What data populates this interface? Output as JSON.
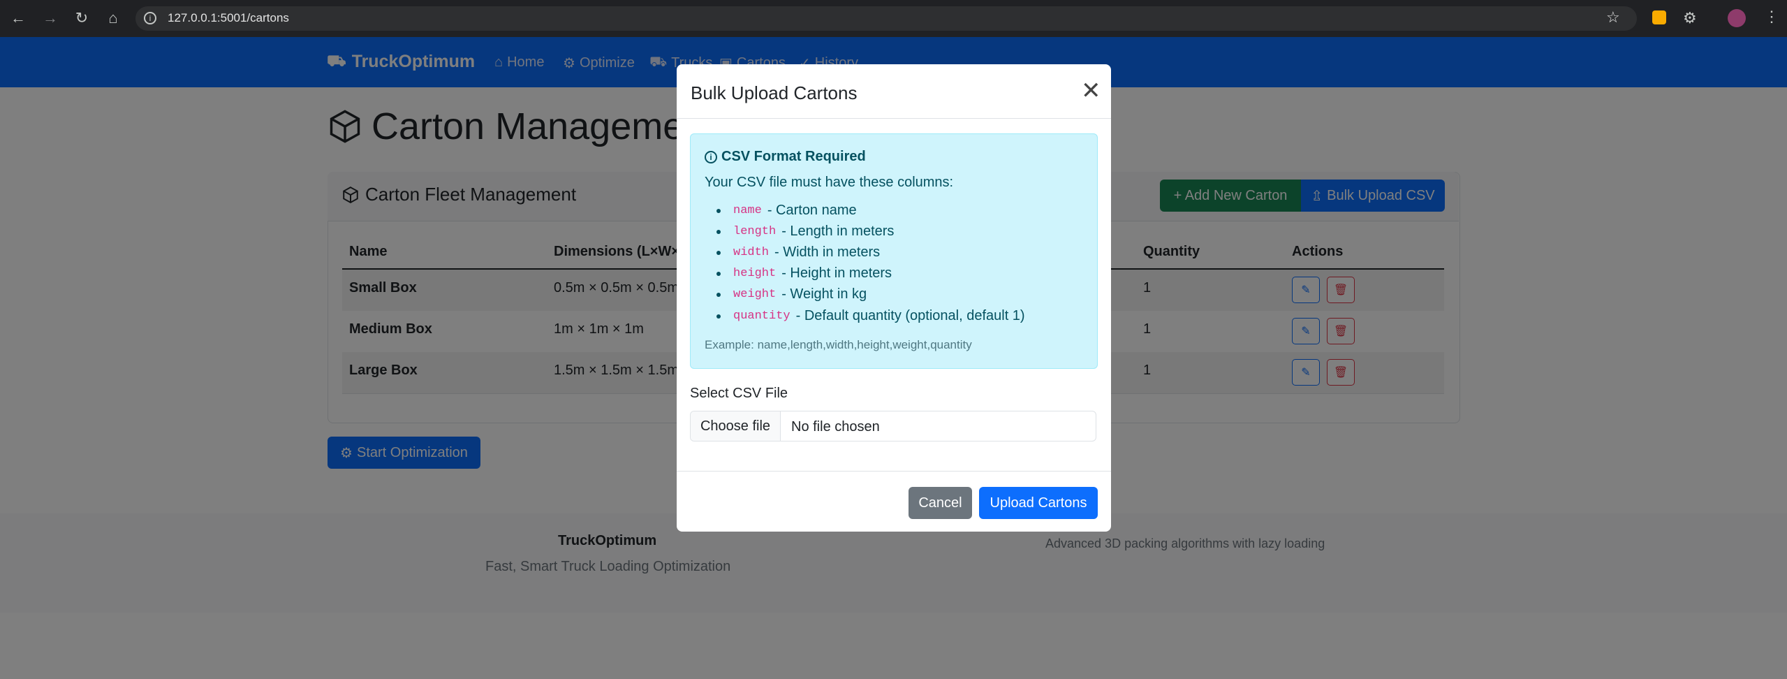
{
  "browser": {
    "url": "127.0.0.1:5001/cartons"
  },
  "navbar": {
    "brand": "TruckOptimum",
    "links": [
      "Home",
      "Optimize",
      "Trucks",
      "Cartons",
      "History"
    ]
  },
  "page": {
    "title": "Carton Management"
  },
  "card": {
    "title": "Carton Fleet Management",
    "add_button": "+ Add New Carton",
    "bulk_button": "Bulk Upload CSV",
    "columns": [
      "Name",
      "Dimensions (L×W×H)",
      "Quantity",
      "Actions"
    ],
    "rows": [
      {
        "name": "Small Box",
        "dimensions": "0.5m × 0.5m × 0.5m",
        "quantity": "1"
      },
      {
        "name": "Medium Box",
        "dimensions": "1m × 1m × 1m",
        "quantity": "1"
      },
      {
        "name": "Large Box",
        "dimensions": "1.5m × 1.5m × 1.5m",
        "quantity": "1"
      }
    ]
  },
  "start_button": "Start Optimization",
  "footer": {
    "brand": "TruckOptimum",
    "tagline": "Fast, Smart Truck Loading Optimization",
    "right_text": "Advanced 3D packing algorithms with lazy loading"
  },
  "modal": {
    "title": "Bulk Upload Cartons",
    "alert_title": "CSV Format Required",
    "alert_intro": "Your CSV file must have these columns:",
    "columns": [
      {
        "code": "name",
        "desc": "- Carton name"
      },
      {
        "code": "length",
        "desc": "- Length in meters"
      },
      {
        "code": "width",
        "desc": "- Width in meters"
      },
      {
        "code": "height",
        "desc": "- Height in meters"
      },
      {
        "code": "weight",
        "desc": "- Weight in kg"
      },
      {
        "code": "quantity",
        "desc": "- Default quantity (optional, default 1)"
      }
    ],
    "example": "Example: name,length,width,height,weight,quantity",
    "file_label": "Select CSV File",
    "choose_file": "Choose file",
    "no_file": "No file chosen",
    "cancel": "Cancel",
    "upload": "Upload Cartons"
  },
  "colors": {
    "primary": "#0d6efd",
    "success": "#198754",
    "danger": "#dc3545",
    "secondary": "#6c757d"
  }
}
